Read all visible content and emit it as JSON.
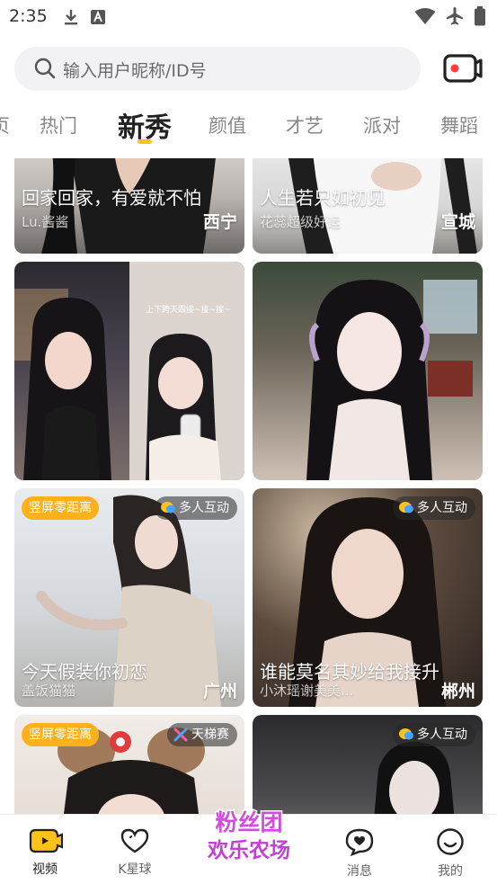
{
  "status": {
    "time": "2:35"
  },
  "search": {
    "placeholder": "输入用户昵称/ID号"
  },
  "tabs": [
    {
      "label": "页"
    },
    {
      "label": "热门"
    },
    {
      "label": "新秀"
    },
    {
      "label": "颜值"
    },
    {
      "label": "才艺"
    },
    {
      "label": "派对"
    },
    {
      "label": "舞蹈"
    }
  ],
  "cards": [
    {
      "title": "回家回家，有爱就不怕",
      "user": "Lu.酱酱",
      "city": "西宁"
    },
    {
      "title": "人生若只如初见",
      "user": "花蕊超级好运",
      "city": "宣城"
    },
    {
      "title": "",
      "user": "",
      "city": ""
    },
    {
      "title": "",
      "user": "",
      "city": ""
    },
    {
      "title": "今天假装你初恋",
      "user": "盖饭猫猫",
      "city": "广州",
      "badge_left": "竖屏零距离",
      "badge_right": "多人互动"
    },
    {
      "title": "谁能莫名其妙给我接升",
      "user": "小沐瑶谢美美...",
      "city": "郴州",
      "badge_right": "多人互动"
    },
    {
      "badge_left": "竖屏零距离",
      "badge_right": "天梯赛"
    },
    {
      "badge_right": "多人互动"
    }
  ],
  "card3_overlay": "上下跨天跟接~接~接~",
  "bottom_nav": [
    {
      "label": "视频",
      "icon": "video-icon"
    },
    {
      "label": "K星球",
      "icon": "heart-icon"
    },
    {
      "label": "粉丝团欢乐农场",
      "icon": "fan-farm-logo"
    },
    {
      "label": "消息",
      "icon": "message-icon"
    },
    {
      "label": "我的",
      "icon": "profile-icon"
    }
  ],
  "colors": {
    "accent": "#ffc21a",
    "badge_orange": "#ffb11c",
    "nav_active": "#ffc21a"
  }
}
